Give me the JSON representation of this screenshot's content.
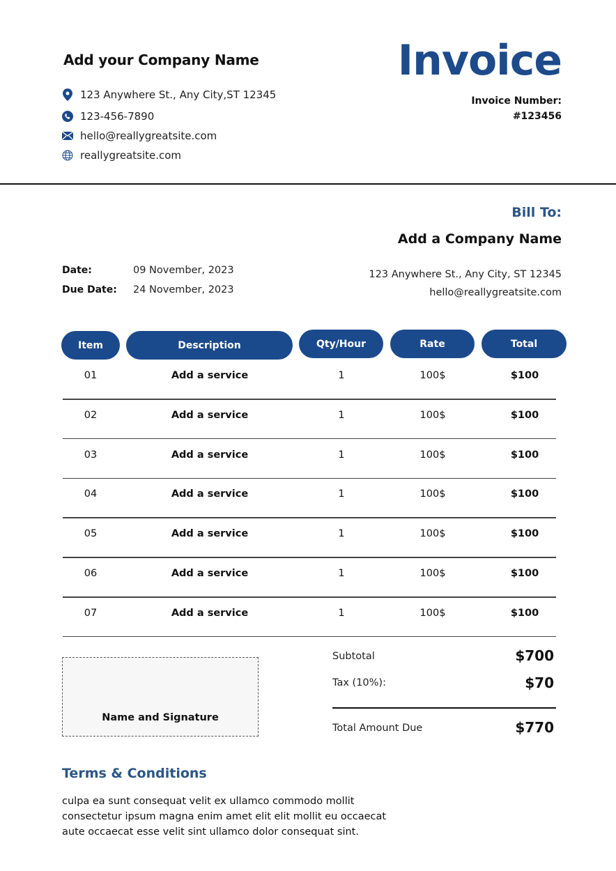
{
  "sender": {
    "company_name": "Add your Company Name",
    "address": "123 Anywhere St., Any City,ST 12345",
    "phone": "123-456-7890",
    "email": "hello@reallygreatsite.com",
    "website": "reallygreatsite.com",
    "icons": [
      "location-pin-icon",
      "phone-icon",
      "mail-icon",
      "globe-icon"
    ]
  },
  "invoice": {
    "title": "Invoice",
    "number_label": "Invoice Number:",
    "number": "#123456"
  },
  "bill_to": {
    "label": "Bill To:",
    "company_name": "Add a Company Name",
    "address": "123 Anywhere St., Any City, ST 12345",
    "email": "hello@reallygreatsite.com"
  },
  "dates": {
    "date_label": "Date:",
    "date": "09 November, 2023",
    "due_label": "Due Date:",
    "due_date": "24 November, 2023"
  },
  "table": {
    "headers": [
      "Item",
      "Description",
      "Qty/Hour",
      "Rate",
      "Total"
    ],
    "rows": [
      {
        "item": "01",
        "description": "Add a service",
        "qty": "1",
        "rate": "100$",
        "total": "$100"
      },
      {
        "item": "02",
        "description": "Add a service",
        "qty": "1",
        "rate": "100$",
        "total": "$100"
      },
      {
        "item": "03",
        "description": "Add a service",
        "qty": "1",
        "rate": "100$",
        "total": "$100"
      },
      {
        "item": "04",
        "description": "Add a service",
        "qty": "1",
        "rate": "100$",
        "total": "$100"
      },
      {
        "item": "05",
        "description": "Add a service",
        "qty": "1",
        "rate": "100$",
        "total": "$100"
      },
      {
        "item": "06",
        "description": "Add a service",
        "qty": "1",
        "rate": "100$",
        "total": "$100"
      },
      {
        "item": "07",
        "description": "Add a service",
        "qty": "1",
        "rate": "100$",
        "total": "$100"
      }
    ]
  },
  "signature": {
    "label": "Name and Signature"
  },
  "summary": {
    "subtotal_label": "Subtotal",
    "subtotal": "$700",
    "tax_label": "Tax (10%):",
    "tax": "$70",
    "total_label": "Total Amount Due",
    "total": "$770"
  },
  "terms": {
    "title": "Terms & Conditions",
    "lines": [
      "culpa ea sunt consequat velit ex ullamco commodo mollit",
      "consectetur ipsum magna enim amet elit elit mollit eu occaecat",
      "aute occaecat esse velit sint ullamco dolor consequat sint."
    ]
  },
  "colors": {
    "accent": "#1b4a8c",
    "heading_blue": "#2b5684",
    "text": "#111111"
  }
}
